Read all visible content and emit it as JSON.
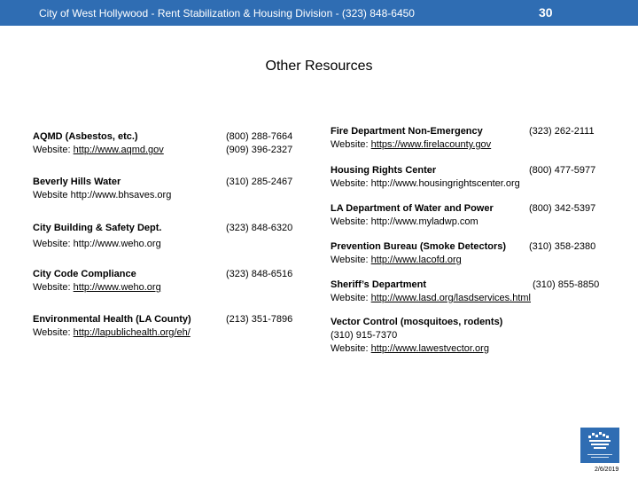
{
  "header": {
    "title": "City of West Hollywood - Rent Stabilization & Housing Division - (323) 848-6450",
    "page_number": "30"
  },
  "page_title": "Other Resources",
  "left": [
    {
      "name": "AQMD (Asbestos, etc.)",
      "web_label": "Website:",
      "web_url": "http://www.aqmd.gov",
      "phones": [
        "(800) 288-7664",
        "(909) 396-2327"
      ]
    },
    {
      "name": "Beverly Hills Water",
      "web_label": "Website",
      "web_url": "http://www.bhsaves.org",
      "phones": [
        "(310) 285-2467"
      ]
    },
    {
      "name": "City Building & Safety Dept.",
      "web_label": "Website:",
      "web_url": "http://www.weho.org",
      "phones": [
        "(323) 848-6320"
      ]
    },
    {
      "name": "City Code Compliance",
      "web_label": "Website:",
      "web_url": "http://www.weho.org",
      "phones": [
        "(323) 848-6516"
      ]
    },
    {
      "name": "Environmental Health (LA County)",
      "web_label": "Website:",
      "web_url": "http://lapublichealth.org/eh/",
      "phones": [
        "(213) 351-7896"
      ]
    }
  ],
  "right": [
    {
      "name": "Fire Department Non-Emergency",
      "phone": "(323) 262-2111",
      "web_label": "Website:",
      "web_url": "https://www.firelacounty.gov"
    },
    {
      "name": "Housing Rights Center",
      "phone": "(800) 477-5977",
      "web_label": "Website:",
      "web_url": "http://www.housingrightscenter.org"
    },
    {
      "name": "LA Department of Water and Power",
      "phone": "(800) 342-5397",
      "web_label": "Website:",
      "web_url": "http://www.myladwp.com"
    },
    {
      "name": "Prevention Bureau (Smoke Detectors)",
      "phone": "(310) 358-2380",
      "web_label": "Website:",
      "web_url": "http://www.lacofd.org"
    },
    {
      "name": "Sheriff’s Department",
      "phone": "(310) 855-8850",
      "web_label": "Website:",
      "web_url": "http://www.lasd.org/lasdservices.html"
    },
    {
      "name": "Vector Control (mosquitoes, rodents)",
      "phone": "(310) 915-7370",
      "web_label": "Website:",
      "web_url": "http://www.lawestvector.org"
    }
  ],
  "footer": {
    "date": "2/6/2019"
  },
  "colors": {
    "header_bg": "#2f6db3"
  }
}
